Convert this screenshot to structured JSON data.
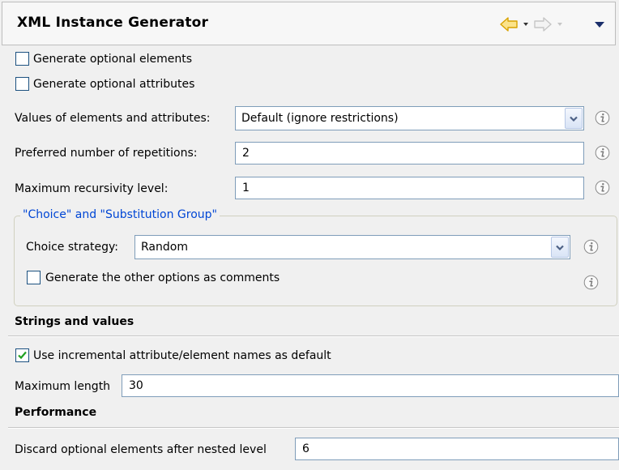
{
  "header": {
    "title": "XML Instance Generator",
    "icons": {
      "back": "back-arrow-icon",
      "forward": "forward-arrow-icon",
      "menu": "view-menu-icon"
    },
    "colors": {
      "back_arrow": "#f1c22b",
      "forward_arrow_disabled": "#c8c8c8",
      "menu_arrow": "#1b2f6b"
    }
  },
  "options": {
    "generate_optional_elements": {
      "label": "Generate optional elements",
      "checked": false
    },
    "generate_optional_attributes": {
      "label": "Generate optional attributes",
      "checked": false
    }
  },
  "fields": {
    "values_mode": {
      "label": "Values of elements and attributes:",
      "selected": "Default (ignore restrictions)"
    },
    "repetitions": {
      "label": "Preferred number of repetitions:",
      "value": "2"
    },
    "recursivity": {
      "label": "Maximum recursivity level:",
      "value": "1"
    }
  },
  "choice_group": {
    "title": "\"Choice\" and \"Substitution Group\"",
    "strategy_label": "Choice strategy:",
    "strategy_selected": "Random",
    "comments_option": {
      "label": "Generate the other options as comments",
      "checked": false
    }
  },
  "strings_section": {
    "title": "Strings and values",
    "incremental_names": {
      "label": "Use incremental attribute/element names as default",
      "checked": true
    },
    "max_length": {
      "label": "Maximum length",
      "value": "30"
    }
  },
  "performance_section": {
    "title": "Performance",
    "discard_level": {
      "label": "Discard optional elements after nested level",
      "value": "6"
    }
  },
  "info_icon": "info-icon"
}
